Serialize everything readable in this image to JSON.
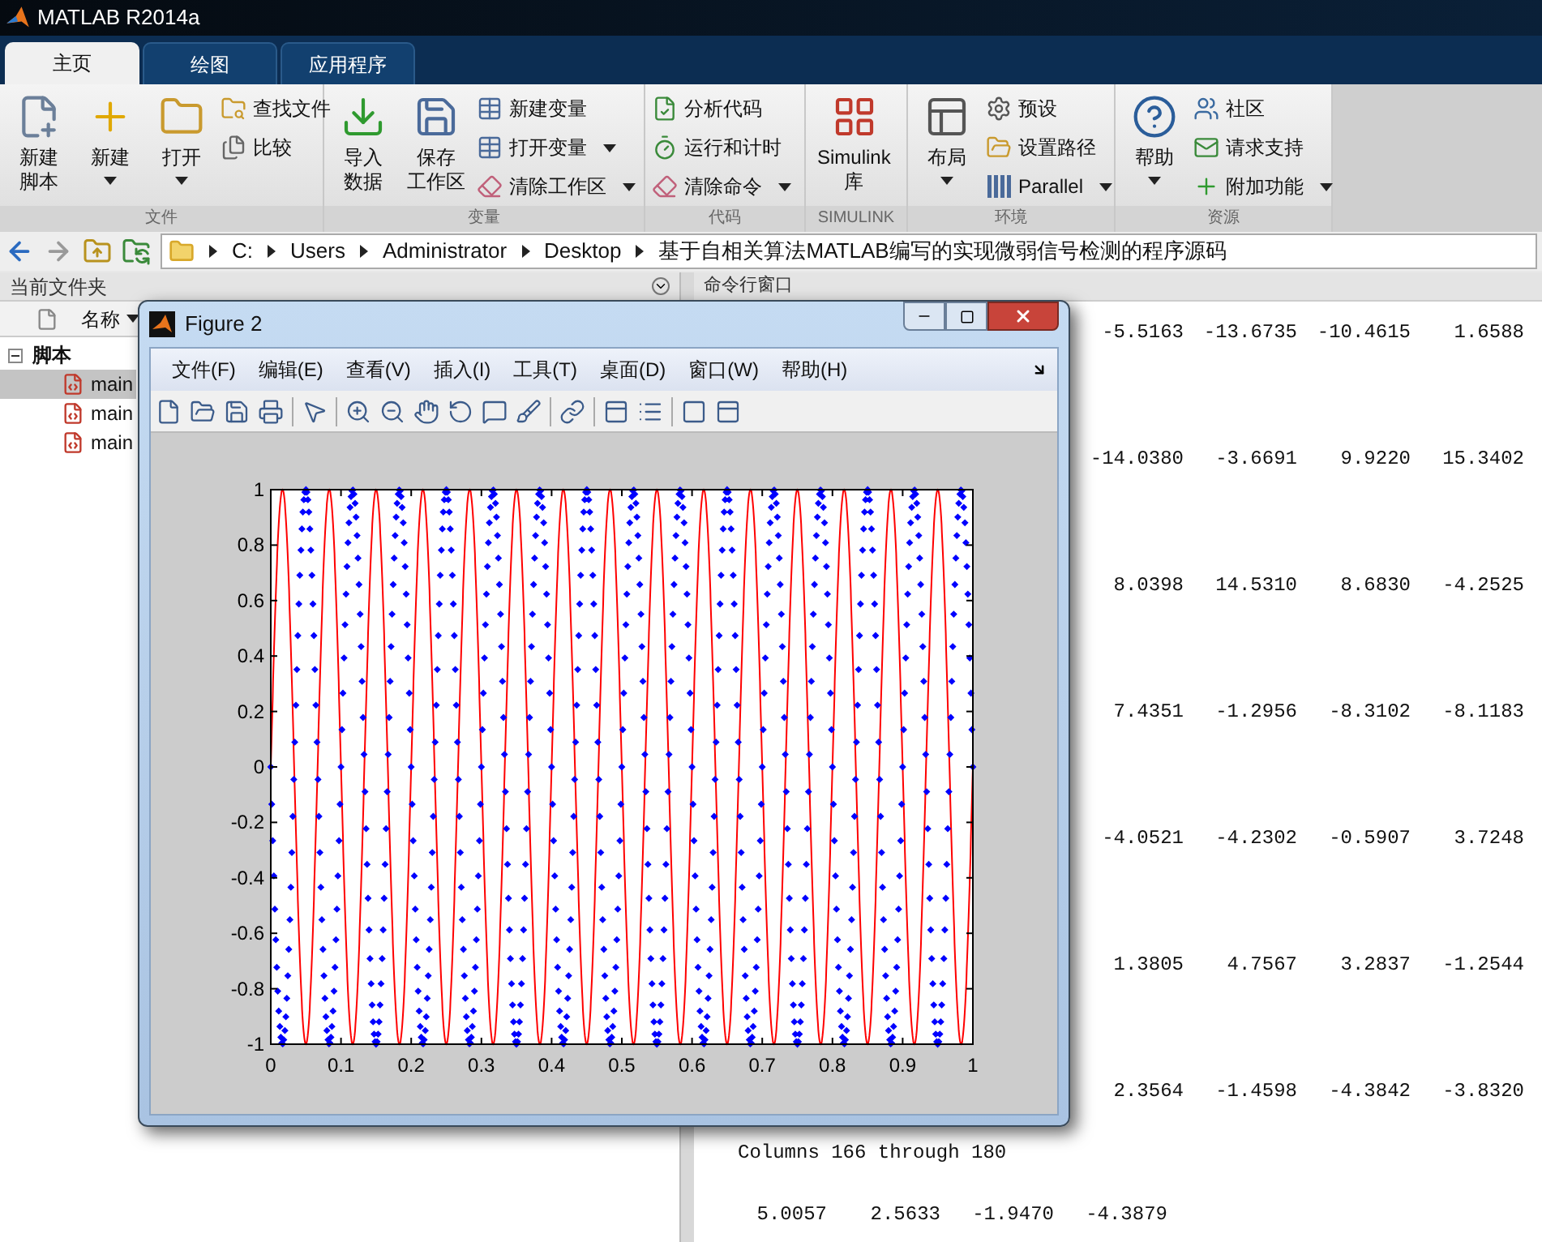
{
  "window": {
    "title": "MATLAB R2014a"
  },
  "tabs": [
    {
      "label": "主页",
      "selected": true
    },
    {
      "label": "绘图",
      "selected": false
    },
    {
      "label": "应用程序",
      "selected": false
    }
  ],
  "ribbon": {
    "groups": [
      {
        "title": "文件",
        "items": [
          {
            "kind": "large",
            "lines": [
              "新建",
              "脚本"
            ],
            "dropdown": false
          },
          {
            "kind": "large",
            "lines": [
              "新建"
            ],
            "dropdown": true
          },
          {
            "kind": "large",
            "lines": [
              "打开"
            ],
            "dropdown": true
          },
          {
            "kind": "stack",
            "entries": [
              {
                "label": "查找文件",
                "dropdown": false
              },
              {
                "label": "比较",
                "dropdown": false
              }
            ]
          }
        ]
      },
      {
        "title": "变量",
        "items": [
          {
            "kind": "large",
            "lines": [
              "导入",
              "数据"
            ],
            "dropdown": false
          },
          {
            "kind": "large",
            "lines": [
              "保存",
              "工作区"
            ],
            "dropdown": false
          },
          {
            "kind": "stack",
            "entries": [
              {
                "label": "新建变量",
                "dropdown": false
              },
              {
                "label": "打开变量",
                "dropdown": true
              },
              {
                "label": "清除工作区",
                "dropdown": true
              }
            ]
          }
        ]
      },
      {
        "title": "代码",
        "items": [
          {
            "kind": "stack",
            "entries": [
              {
                "label": "分析代码",
                "dropdown": false
              },
              {
                "label": "运行和计时",
                "dropdown": false
              },
              {
                "label": "清除命令",
                "dropdown": true
              }
            ]
          }
        ]
      },
      {
        "title": "SIMULINK",
        "items": [
          {
            "kind": "large",
            "lines": [
              "Simulink",
              "库"
            ],
            "dropdown": false
          }
        ]
      },
      {
        "title": "环境",
        "items": [
          {
            "kind": "large",
            "lines": [
              "布局"
            ],
            "dropdown": true
          },
          {
            "kind": "stack",
            "entries": [
              {
                "label": "预设",
                "dropdown": false
              },
              {
                "label": "设置路径",
                "dropdown": false
              },
              {
                "label": "Parallel",
                "dropdown": true
              }
            ]
          }
        ]
      },
      {
        "title": "资源",
        "items": [
          {
            "kind": "large",
            "lines": [
              "帮助"
            ],
            "dropdown": true
          },
          {
            "kind": "stack",
            "entries": [
              {
                "label": "社区",
                "dropdown": false
              },
              {
                "label": "请求支持",
                "dropdown": false
              },
              {
                "label": "附加功能",
                "dropdown": true
              }
            ]
          }
        ]
      }
    ]
  },
  "address_bar": {
    "path": [
      "C:",
      "Users",
      "Administrator",
      "Desktop",
      "基于自相关算法MATLAB编写的实现微弱信号检测的程序源码"
    ]
  },
  "current_folder": {
    "title": "当前文件夹",
    "column": "名称",
    "tree": [
      {
        "label": "脚本",
        "expanded": true,
        "children": [
          {
            "label": "main",
            "selected": true
          },
          {
            "label": "main",
            "selected": false
          },
          {
            "label": "main",
            "selected": false
          }
        ]
      }
    ]
  },
  "command_window": {
    "title": "命令行窗口",
    "lines": [
      {
        "kind": "tail",
        "values": [
          "-5.5163",
          "-13.6735",
          "-10.4615",
          "1.6588"
        ]
      },
      {
        "kind": "tail",
        "values": [
          "-14.0380",
          "-3.6691",
          "9.9220",
          "15.3402"
        ]
      },
      {
        "kind": "tail",
        "values": [
          "8.0398",
          "14.5310",
          "8.6830",
          "-4.2525"
        ]
      },
      {
        "kind": "tail",
        "values": [
          "7.4351",
          "-1.2956",
          "-8.3102",
          "-8.1183"
        ]
      },
      {
        "kind": "tail",
        "values": [
          "-4.0521",
          "-4.2302",
          "-0.5907",
          "3.7248"
        ]
      },
      {
        "kind": "tail",
        "values": [
          "1.3805",
          "4.7567",
          "3.2837",
          "-1.2544"
        ]
      },
      {
        "kind": "tail",
        "values": [
          "2.3564",
          "-1.4598",
          "-4.3842",
          "-3.8320"
        ]
      },
      {
        "kind": "text",
        "text": "Columns 166 through 180"
      },
      {
        "kind": "head",
        "values": [
          "5.0057",
          "2.5633",
          "-1.9470",
          "-4.3879"
        ]
      }
    ]
  },
  "figure": {
    "title": "Figure 2",
    "menus": [
      "文件(F)",
      "编辑(E)",
      "查看(V)",
      "插入(I)",
      "工具(T)",
      "桌面(D)",
      "窗口(W)",
      "帮助(H)"
    ],
    "plot": {
      "yticks": [
        "1",
        "0.8",
        "0.6",
        "0.4",
        "0.2",
        "0",
        "-0.2",
        "-0.4",
        "-0.6",
        "-0.8",
        "-1"
      ],
      "xticks": [
        "0",
        "0.1",
        "0.2",
        "0.3",
        "0.4",
        "0.5",
        "0.6",
        "0.7",
        "0.8",
        "0.9",
        "1"
      ]
    }
  }
}
